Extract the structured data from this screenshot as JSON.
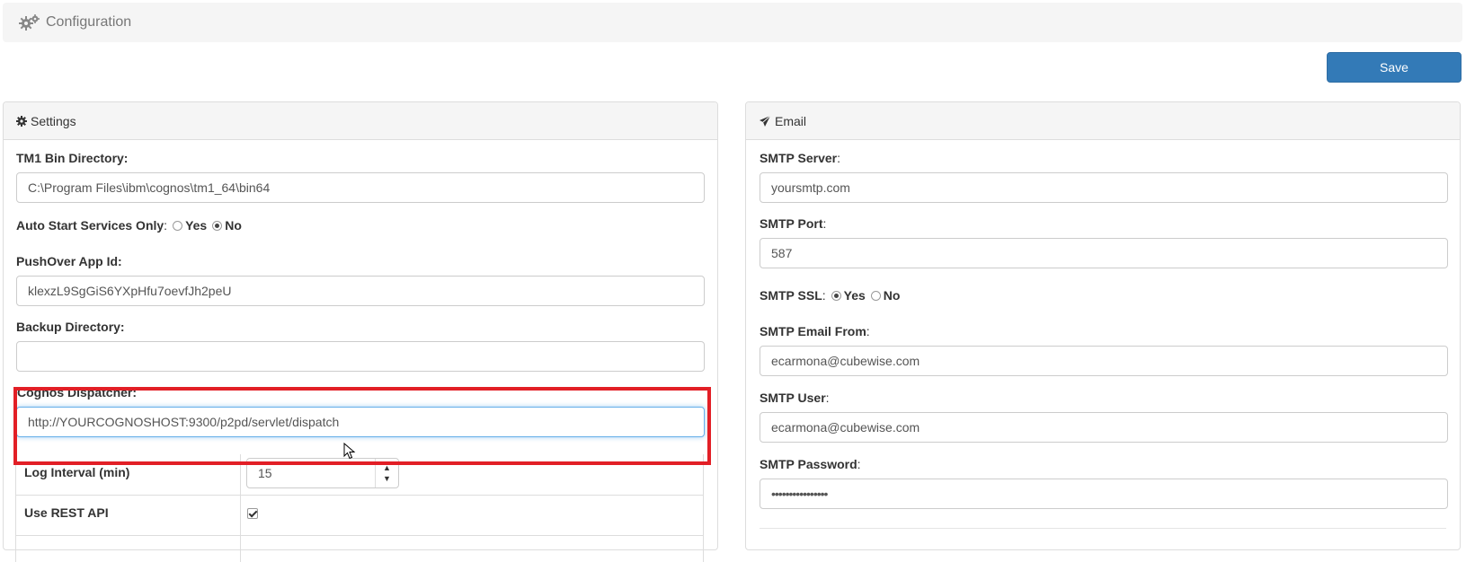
{
  "header": {
    "title": "Configuration",
    "icon": "gears-icon"
  },
  "toolbar": {
    "save_label": "Save"
  },
  "settings": {
    "heading": "Settings",
    "heading_icon": "gear-icon",
    "tm1_bin_label": "TM1 Bin Directory:",
    "tm1_bin_value": "C:\\Program Files\\ibm\\cognos\\tm1_64\\bin64",
    "auto_start_label": "Auto Start Services Only",
    "auto_start_colon": ":",
    "auto_start_options": [
      "Yes",
      "No"
    ],
    "auto_start_selected": "No",
    "pushover_label": "PushOver App Id:",
    "pushover_value": "klexzL9SgGiS6YXpHfu7oevfJh2peU",
    "backup_label": "Backup Directory:",
    "backup_value": "",
    "cognos_label": "Cognos Dispatcher:",
    "cognos_value": "http://YOURCOGNOSHOST:9300/p2pd/servlet/dispatch",
    "log_interval_label": "Log Interval (min)",
    "log_interval_value": "15",
    "use_rest_label": "Use REST API",
    "use_rest_checked": true
  },
  "email": {
    "heading": "Email",
    "heading_icon": "paper-plane-icon",
    "smtp_server_label": "SMTP Server",
    "smtp_server_value": "yoursmtp.com",
    "smtp_port_label": "SMTP Port",
    "smtp_port_value": "587",
    "smtp_ssl_label": "SMTP SSL",
    "smtp_ssl_options": [
      "Yes",
      "No"
    ],
    "smtp_ssl_selected": "Yes",
    "smtp_from_label": "SMTP Email From",
    "smtp_from_value": "ecarmona@cubewise.com",
    "smtp_user_label": "SMTP User",
    "smtp_user_value": "ecarmona@cubewise.com",
    "smtp_password_label": "SMTP Password",
    "smtp_password_value": "••••••••••••••••",
    "colon": ":"
  },
  "colors": {
    "primary": "#337ab7",
    "highlight": "#e21f26",
    "focus": "#66afe9"
  }
}
